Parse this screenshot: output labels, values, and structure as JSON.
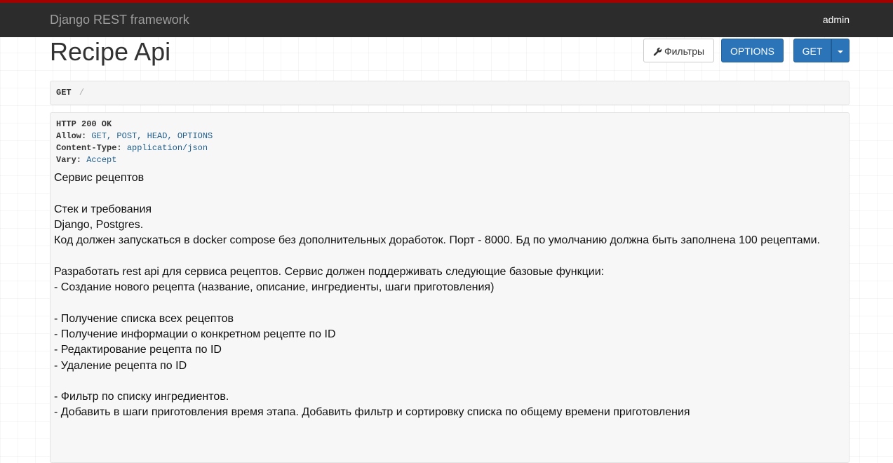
{
  "navbar": {
    "brand": "Django REST framework",
    "user": "admin"
  },
  "page": {
    "title": "Recipe Api"
  },
  "buttons": {
    "filters_label": "Фильтры",
    "options_label": "OPTIONS",
    "get_label": "GET"
  },
  "request": {
    "method": "GET",
    "path": "/"
  },
  "response": {
    "status": "HTTP 200 OK",
    "headers": [
      {
        "name": "Allow:",
        "value": "GET, POST, HEAD, OPTIONS"
      },
      {
        "name": "Content-Type:",
        "value": "application/json"
      },
      {
        "name": "Vary:",
        "value": "Accept"
      }
    ]
  },
  "description": {
    "lines": [
      "Сервис рецептов",
      "",
      "Стек и требования",
      "Django, Postgres.",
      "Код должен запускаться в docker compose без дополнительных доработок. Порт - 8000. Бд по умолчанию должна быть заполнена 100 рецептами.",
      "",
      "Разработать rest api для сервиса рецептов. Сервис должен поддерживать следующие базовые функции:",
      "- Создание нового рецепта (название, описание, ингредиенты, шаги приготовления)",
      "",
      "- Получение списка всех рецептов",
      "- Получение информации о конкретном рецепте по ID",
      "- Редактирование рецепта по ID",
      "- Удаление рецепта по ID",
      "",
      "- Фильтр по списку ингредиентов.",
      "- Добавить в шаги приготовления время этапа. Добавить фильтр и сортировку списка по общему времени приготовления"
    ]
  },
  "colors": {
    "navbar_bg": "#2c2c2c",
    "navbar_accent": "#a30000",
    "primary_button": "#2c74b8",
    "header_value": "#1d5c8b"
  },
  "icons": {
    "filters": "wrench-icon",
    "dropdown": "caret-down-icon"
  }
}
